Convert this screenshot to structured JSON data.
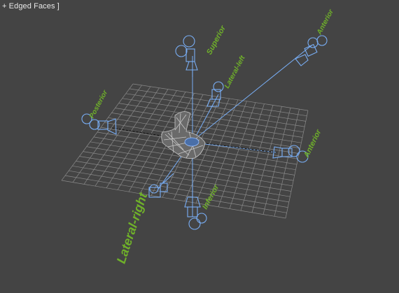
{
  "viewport": {
    "label": "+ Edged Faces ]",
    "background": "#444444",
    "grid_color": "#8a8a8a",
    "camera_color": "#79aef5",
    "label_color": "#6fb02a",
    "mesh_color": "#c8c8c8"
  },
  "cameras": [
    {
      "id": "top",
      "label": "Superior"
    },
    {
      "id": "top-right",
      "label": "Anterior"
    },
    {
      "id": "back-left",
      "label": "Lateral-left"
    },
    {
      "id": "left",
      "label": "Posterior"
    },
    {
      "id": "right",
      "label": "Anterior"
    },
    {
      "id": "bottom",
      "label": "Inferior"
    },
    {
      "id": "front-left",
      "label": "Lateral-right"
    }
  ]
}
